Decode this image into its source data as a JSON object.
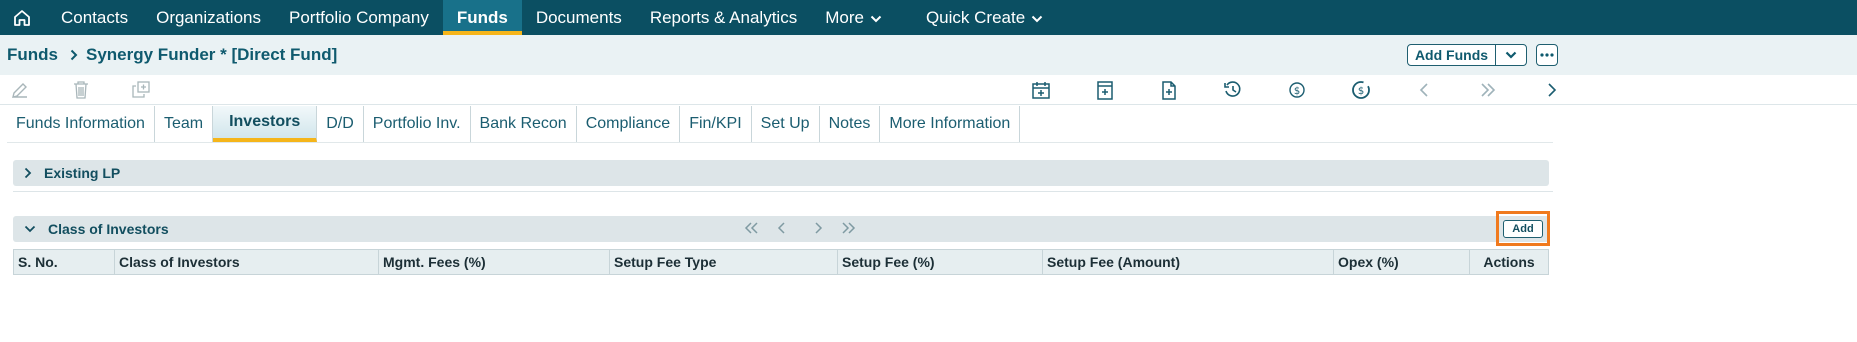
{
  "nav": {
    "items": [
      {
        "label": "Contacts"
      },
      {
        "label": "Organizations"
      },
      {
        "label": "Portfolio Company"
      },
      {
        "label": "Funds"
      },
      {
        "label": "Documents"
      },
      {
        "label": "Reports & Analytics"
      },
      {
        "label": "More"
      },
      {
        "label": "Quick Create"
      }
    ]
  },
  "breadcrumb": {
    "root": "Funds",
    "current": "Synergy Funder * [Direct Fund]"
  },
  "actions": {
    "add_funds": "Add Funds"
  },
  "tabs": [
    {
      "label": "Funds Information"
    },
    {
      "label": "Team"
    },
    {
      "label": "Investors"
    },
    {
      "label": "D/D"
    },
    {
      "label": "Portfolio Inv."
    },
    {
      "label": "Bank Recon"
    },
    {
      "label": "Compliance"
    },
    {
      "label": "Fin/KPI"
    },
    {
      "label": "Set Up"
    },
    {
      "label": "Notes"
    },
    {
      "label": "More Information"
    }
  ],
  "existing_lp": {
    "title": "Existing LP"
  },
  "class_of_investors": {
    "title": "Class of Investors",
    "add_label": "Add",
    "columns": [
      "S. No.",
      "Class of Investors",
      "Mgmt. Fees (%)",
      "Setup Fee Type",
      "Setup Fee (%)",
      "Setup Fee (Amount)",
      "Opex (%)",
      "Actions"
    ]
  },
  "colors": {
    "nav_bg": "#0b4f62",
    "nav_active": "#18718a",
    "accent": "#f5b51a",
    "highlight": "#f07a1e"
  }
}
